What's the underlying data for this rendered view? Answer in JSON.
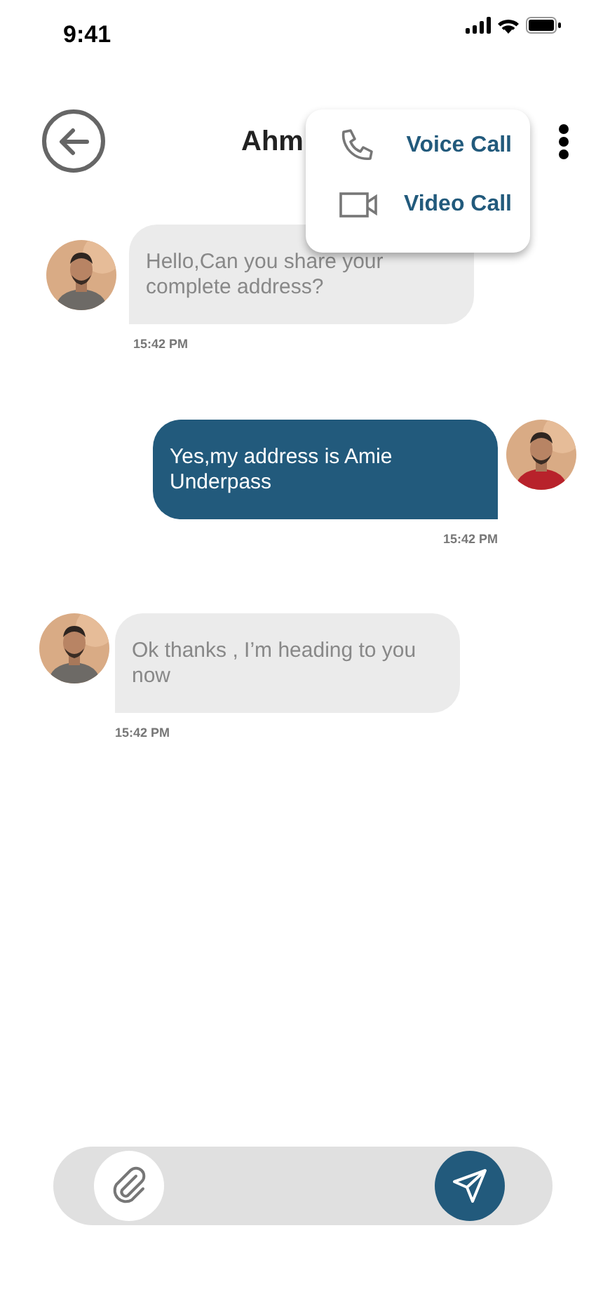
{
  "status_bar": {
    "time": "9:41"
  },
  "header": {
    "title": "Ahm"
  },
  "menu": [
    {
      "kind": "voice",
      "label": "Voice Call"
    },
    {
      "kind": "video",
      "label": "Video Call"
    }
  ],
  "messages": [
    {
      "kind": "incoming",
      "text": "Hello,Can you share your complete address?",
      "time": "15:42 PM"
    },
    {
      "kind": "outgoing",
      "text": "Yes,my address is Amie Underpass",
      "time": "15:42 PM"
    },
    {
      "kind": "incoming",
      "text": "Ok thanks , I’m heading to you now",
      "time": "15:42 PM"
    }
  ]
}
